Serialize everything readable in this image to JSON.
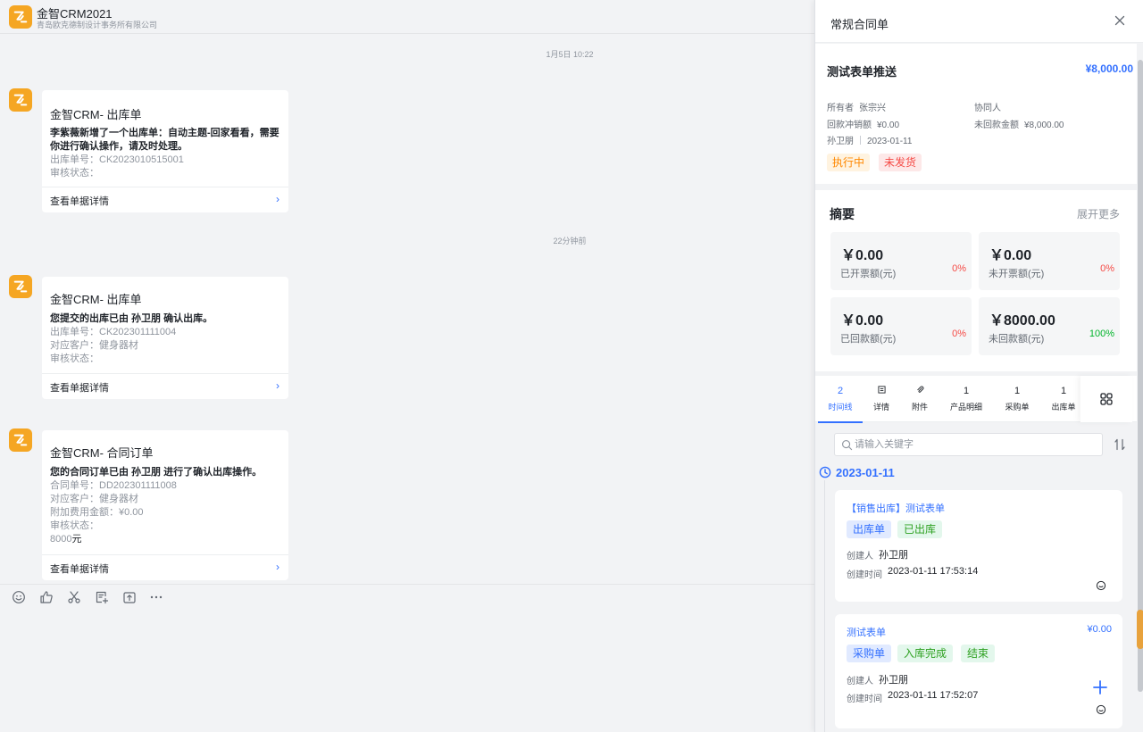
{
  "chat": {
    "title": "金智CRM2021",
    "subtitle": "青岛欧克德制设计事务所有限公司",
    "time_1": "1月5日 10:22",
    "time_2": "22分钟前",
    "messages": [
      {
        "title": "金智CRM- 出库单",
        "bold": "李紫薇新增了一个出库单：自动主题-回家看看，需要你进行确认操作，请及时处理。",
        "lines": [
          "出库单号：CK2023010515001",
          "审核状态："
        ],
        "footer": "查看单据详情"
      },
      {
        "title": "金智CRM- 出库单",
        "bold": "您提交的出库已由 孙卫朋 确认出库。",
        "lines": [
          "出库单号：CK202301111004",
          "对应客户：健身器材",
          "审核状态："
        ],
        "footer": "查看单据详情"
      },
      {
        "title": "金智CRM- 合同订单",
        "bold": "您的合同订单已由 孙卫朋 进行了确认出库操作。",
        "lines": [
          "合同单号：DD202301111008",
          "对应客户：健身器材",
          "附加费用金额：¥0.00",
          "审核状态："
        ],
        "extra_value": "8000",
        "extra_unit": "元",
        "footer": "查看单据详情"
      }
    ],
    "arrow": "›"
  },
  "toolbar": {
    "icons": [
      "emoji-icon",
      "thumbs-up-icon",
      "scissors-icon",
      "add-note-icon",
      "share-icon",
      "more-icon"
    ]
  },
  "panel": {
    "title": "常规合同单",
    "info": {
      "title": "测试表单推送",
      "amount": "¥8,000.00",
      "owner_label": "所有者",
      "owner": "张宗兴",
      "coworker_label": "协同人",
      "offset_label": "回款冲销额",
      "offset": "¥0.00",
      "unpaid_label": "未回款金额",
      "unpaid": "¥8,000.00",
      "person": "孙卫朋",
      "date": "2023-01-11",
      "tag_1": "执行中",
      "tag_2": "未发货"
    },
    "summary": {
      "title": "摘要",
      "more": "展开更多",
      "stats": [
        {
          "value": "￥0.00",
          "label": "已开票额(元)",
          "pct": "0%",
          "pct_color": "#f54a45"
        },
        {
          "value": "￥0.00",
          "label": "未开票额(元)",
          "pct": "0%",
          "pct_color": "#f54a45"
        },
        {
          "value": "￥0.00",
          "label": "已回款额(元)",
          "pct": "0%",
          "pct_color": "#f54a45"
        },
        {
          "value": "￥8000.00",
          "label": "未回款额(元)",
          "pct": "100%",
          "pct_color": "#00b42a"
        }
      ]
    },
    "tabs": [
      {
        "top": "2",
        "label": "时间线"
      },
      {
        "top": "",
        "label": "详情"
      },
      {
        "top": "",
        "label": "附件"
      },
      {
        "top": "1",
        "label": "产品明细"
      },
      {
        "top": "1",
        "label": "采购单"
      },
      {
        "top": "1",
        "label": "出库单"
      }
    ],
    "search_placeholder": "请输入关键字",
    "timeline_date": "2023-01-11",
    "entries": [
      {
        "title": "【销售出库】测试表单",
        "amount": "",
        "tags": [
          "出库单",
          "已出库"
        ],
        "creator_label": "创建人",
        "creator": "孙卫朋",
        "time_label": "创建时间",
        "time": "2023-01-11 17:53:14"
      },
      {
        "title": "测试表单",
        "amount": "¥0.00",
        "tags": [
          "采购单",
          "入库完成",
          "结束"
        ],
        "creator_label": "创建人",
        "creator": "孙卫朋",
        "time_label": "创建时间",
        "time": "2023-01-11 17:52:07"
      }
    ]
  },
  "colors": {
    "accent": "#3370ff",
    "brand": "#f5a623",
    "tag_orange_bg": "#fff3e0",
    "tag_orange_fg": "#ff8800",
    "tag_red_bg": "#fde8e8",
    "tag_red_fg": "#f54a45",
    "tag_blue_bg": "#e1eaff",
    "tag_green_bg": "#e3f7ec",
    "tag_green_fg": "#2ea121"
  }
}
